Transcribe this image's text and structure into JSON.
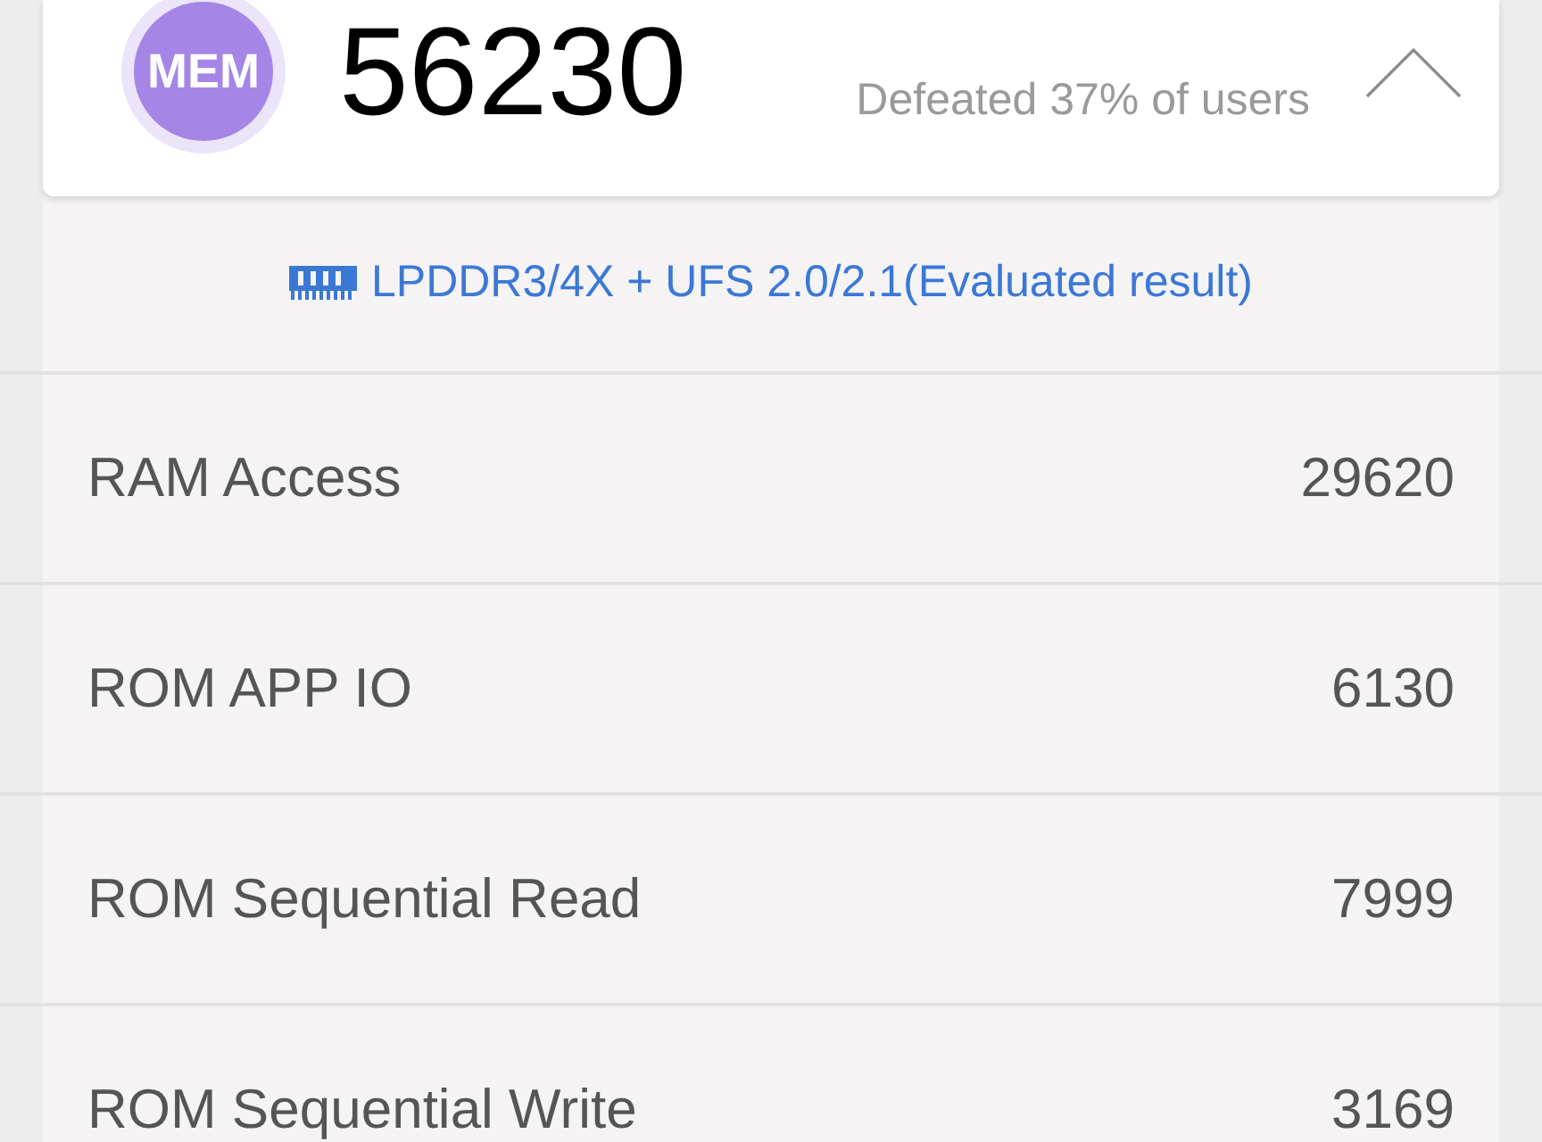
{
  "score_card": {
    "badge": "MEM",
    "score": "56230",
    "rank": "Defeated 37% of users",
    "expanded": true
  },
  "memory_type": "LPDDR3/4X + UFS 2.0/2.1(Evaluated result)",
  "results": [
    {
      "label": "RAM Access",
      "value": "29620"
    },
    {
      "label": "ROM APP IO",
      "value": "6130"
    },
    {
      "label": "ROM Sequential Read",
      "value": "7999"
    },
    {
      "label": "ROM Sequential Write",
      "value": "3169"
    }
  ]
}
